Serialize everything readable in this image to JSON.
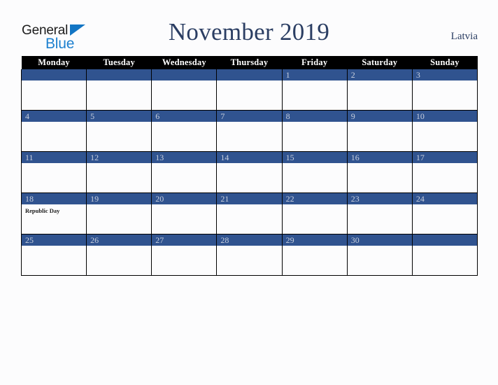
{
  "brand": {
    "line1": "General",
    "line2": "Blue",
    "triangle_color": "#1275c4",
    "line2_color": "#1d80cf"
  },
  "header": {
    "title": "November 2019",
    "country": "Latvia",
    "title_color": "#2b3e63"
  },
  "colors": {
    "header_row_bg": "#000000",
    "day_bar_bg": "#30538f",
    "day_number_text": "#c8cfdd",
    "cell_bg": "#fcfcfd",
    "page_bg": "#fcfcfd",
    "grid_line": "#000000"
  },
  "calendar": {
    "weekday_headers": [
      "Monday",
      "Tuesday",
      "Wednesday",
      "Thursday",
      "Friday",
      "Saturday",
      "Sunday"
    ],
    "weeks": [
      [
        {
          "day": "",
          "holiday": ""
        },
        {
          "day": "",
          "holiday": ""
        },
        {
          "day": "",
          "holiday": ""
        },
        {
          "day": "",
          "holiday": ""
        },
        {
          "day": "1",
          "holiday": ""
        },
        {
          "day": "2",
          "holiday": ""
        },
        {
          "day": "3",
          "holiday": ""
        }
      ],
      [
        {
          "day": "4",
          "holiday": ""
        },
        {
          "day": "5",
          "holiday": ""
        },
        {
          "day": "6",
          "holiday": ""
        },
        {
          "day": "7",
          "holiday": ""
        },
        {
          "day": "8",
          "holiday": ""
        },
        {
          "day": "9",
          "holiday": ""
        },
        {
          "day": "10",
          "holiday": ""
        }
      ],
      [
        {
          "day": "11",
          "holiday": ""
        },
        {
          "day": "12",
          "holiday": ""
        },
        {
          "day": "13",
          "holiday": ""
        },
        {
          "day": "14",
          "holiday": ""
        },
        {
          "day": "15",
          "holiday": ""
        },
        {
          "day": "16",
          "holiday": ""
        },
        {
          "day": "17",
          "holiday": ""
        }
      ],
      [
        {
          "day": "18",
          "holiday": "Republic Day"
        },
        {
          "day": "19",
          "holiday": ""
        },
        {
          "day": "20",
          "holiday": ""
        },
        {
          "day": "21",
          "holiday": ""
        },
        {
          "day": "22",
          "holiday": ""
        },
        {
          "day": "23",
          "holiday": ""
        },
        {
          "day": "24",
          "holiday": ""
        }
      ],
      [
        {
          "day": "25",
          "holiday": ""
        },
        {
          "day": "26",
          "holiday": ""
        },
        {
          "day": "27",
          "holiday": ""
        },
        {
          "day": "28",
          "holiday": ""
        },
        {
          "day": "29",
          "holiday": ""
        },
        {
          "day": "30",
          "holiday": ""
        },
        {
          "day": "",
          "holiday": ""
        }
      ]
    ]
  }
}
